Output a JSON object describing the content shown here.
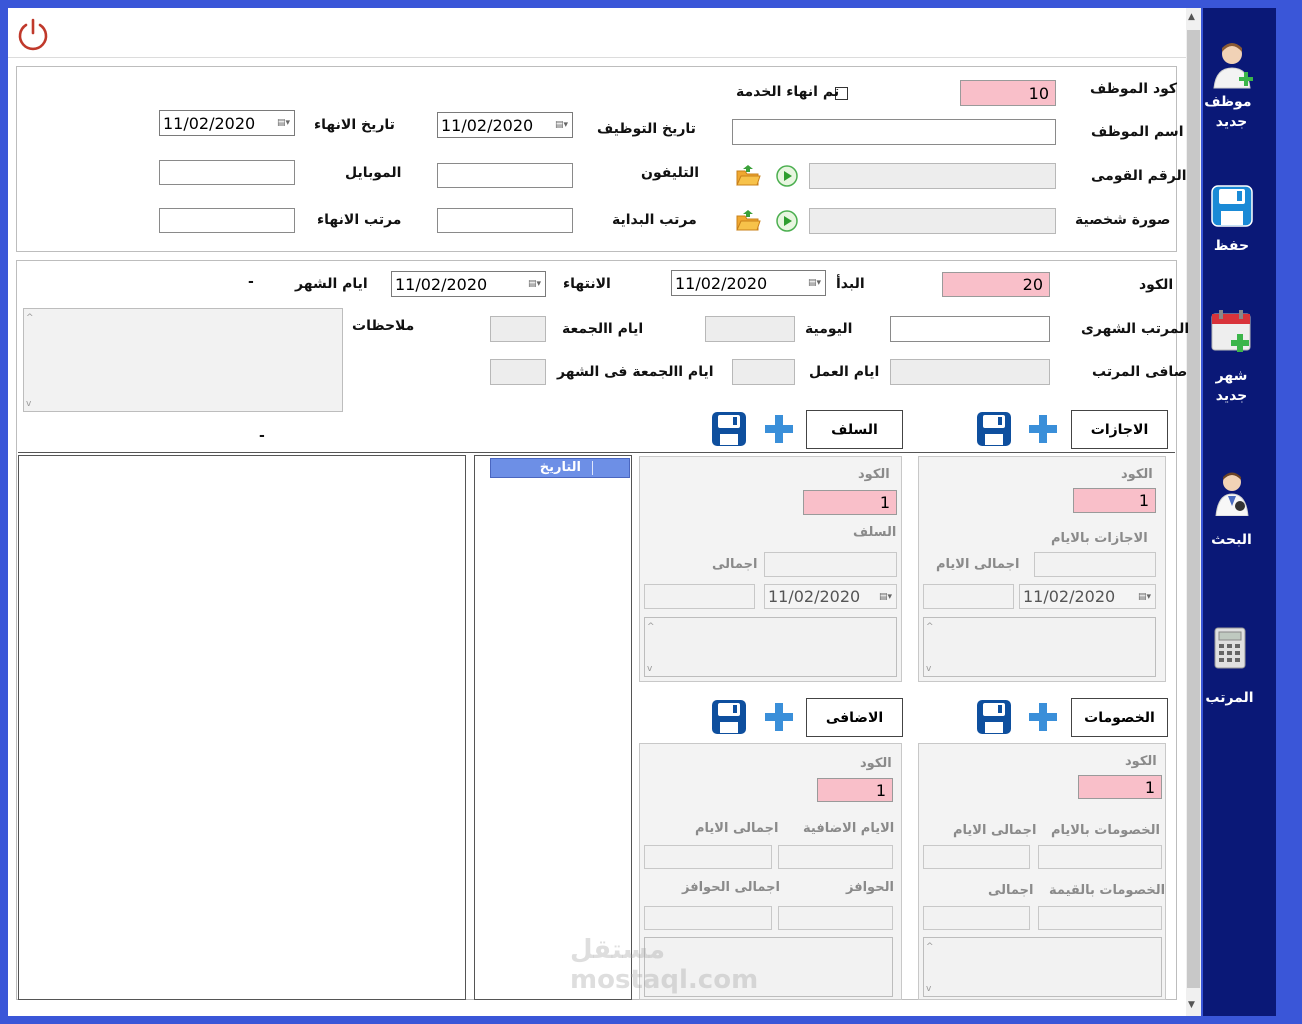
{
  "sidebar": {
    "items": [
      {
        "label": "موظف جديد",
        "icon": "add-user-icon"
      },
      {
        "label": "حفظ",
        "icon": "save-icon"
      },
      {
        "label": "شهر جديد",
        "icon": "calendar-add-icon"
      },
      {
        "label": "البحث",
        "icon": "doctor-search-icon"
      },
      {
        "label": "المرتب",
        "icon": "calculator-icon"
      }
    ]
  },
  "employee": {
    "code_label": "كود الموظف",
    "code_value": "10",
    "service_end_label": "تم انهاء الخدمة",
    "name_label": "اسم الموظف",
    "hire_date_label": "تاريخ التوظيف",
    "hire_date_value": "11/02/2020",
    "end_date_label": "تاريخ الانهاء",
    "end_date_value": "11/02/2020",
    "national_id_label": "الرقم القومى",
    "phone_label": "التليفون",
    "mobile_label": "الموبايل",
    "photo_label": "صورة شخصية",
    "start_salary_label": "مرتب البداية",
    "end_salary_label": "مرتب الانهاء"
  },
  "month": {
    "code_label": "الكود",
    "code_value": "20",
    "start_label": "البدأ",
    "start_value": "11/02/2020",
    "end_label": "الانتهاء",
    "end_value": "11/02/2020",
    "month_days_label": "ايام الشهر",
    "month_days_value": "-",
    "monthly_salary_label": "المرتب الشهرى",
    "daily_label": "اليومية",
    "fridays_label": "ايام االجمعة",
    "notes_label": "ملاحظات",
    "net_salary_label": "صافى المرتب",
    "work_days_label": "ايام العمل",
    "fridays_in_month_label": "ايام االجمعة فى الشهر",
    "dash_value": "-"
  },
  "leaves": {
    "button": "الاجازات",
    "code_label": "الكود",
    "code_value": "1",
    "days_label": "الاجازات بالايام",
    "total_days_label": "اجمالى الايام",
    "date_value": "11/02/2020"
  },
  "advances": {
    "button": "السلف",
    "code_label": "الكود",
    "code_value": "1",
    "advance_label": "السلف",
    "total_label": "اجمالى",
    "date_value": "11/02/2020"
  },
  "deductions": {
    "button": "الخصومات",
    "code_label": "الكود",
    "code_value": "1",
    "days_label": "الخصومات بالايام",
    "total_days_label": "اجمالى الايام",
    "value_label": "الخصومات بالقيمة",
    "total_label": "اجمالى"
  },
  "additions": {
    "button": "الاضافى",
    "code_label": "الكود",
    "code_value": "1",
    "extra_days_label": "الايام الاضافية",
    "total_days_label": "اجمالى الايام",
    "incentives_label": "الحوافز",
    "total_incentives_label": "اجمالى الحوافز"
  },
  "grid": {
    "column_header": "التاريخ"
  },
  "watermark": "مستقل mostaql.com"
}
